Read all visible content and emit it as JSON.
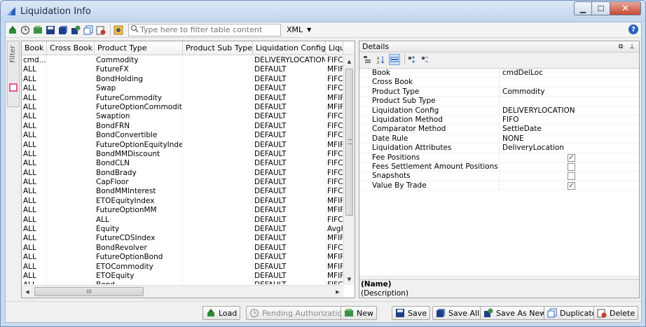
{
  "window": {
    "title": "Liquidation Info"
  },
  "toolbar": {
    "filter_placeholder": "Type here to filter table content",
    "format_selected": "XML"
  },
  "side_tab": {
    "label": "Filter"
  },
  "grid": {
    "columns": [
      "Book",
      "Cross Book",
      "Product Type",
      "Product Sub Type",
      "Liquidation Config",
      "Liqu"
    ],
    "rows": [
      [
        "cmd...",
        "",
        "Commodity",
        "",
        "DELIVERYLOCATION",
        "FIFC"
      ],
      [
        "ALL",
        "",
        "FutureFX",
        "",
        "DEFAULT",
        "MFIF"
      ],
      [
        "ALL",
        "",
        "BondHolding",
        "",
        "DEFAULT",
        "FIFC"
      ],
      [
        "ALL",
        "",
        "Swap",
        "",
        "DEFAULT",
        "FIFC"
      ],
      [
        "ALL",
        "",
        "FutureCommodity",
        "",
        "DEFAULT",
        "MFIF"
      ],
      [
        "ALL",
        "",
        "FutureOptionCommodity",
        "",
        "DEFAULT",
        "MFIF"
      ],
      [
        "ALL",
        "",
        "Swaption",
        "",
        "DEFAULT",
        "FIFC"
      ],
      [
        "ALL",
        "",
        "BondFRN",
        "",
        "DEFAULT",
        "FIFC"
      ],
      [
        "ALL",
        "",
        "BondConvertible",
        "",
        "DEFAULT",
        "FIFC"
      ],
      [
        "ALL",
        "",
        "FutureOptionEquityIndex",
        "",
        "DEFAULT",
        "MFIF"
      ],
      [
        "ALL",
        "",
        "BondMMDiscount",
        "",
        "DEFAULT",
        "FIFC"
      ],
      [
        "ALL",
        "",
        "BondCLN",
        "",
        "DEFAULT",
        "FIFC"
      ],
      [
        "ALL",
        "",
        "BondBrady",
        "",
        "DEFAULT",
        "FIFC"
      ],
      [
        "ALL",
        "",
        "CapFloor",
        "",
        "DEFAULT",
        "FIFC"
      ],
      [
        "ALL",
        "",
        "BondMMInterest",
        "",
        "DEFAULT",
        "FIFC"
      ],
      [
        "ALL",
        "",
        "ETOEquityIndex",
        "",
        "DEFAULT",
        "MFIF"
      ],
      [
        "ALL",
        "",
        "FutureOptionMM",
        "",
        "DEFAULT",
        "MFIF"
      ],
      [
        "ALL",
        "",
        "ALL",
        "",
        "DEFAULT",
        "FIFC"
      ],
      [
        "ALL",
        "",
        "Equity",
        "",
        "DEFAULT",
        "AvgF"
      ],
      [
        "ALL",
        "",
        "FutureCDSIndex",
        "",
        "DEFAULT",
        "MFIF"
      ],
      [
        "ALL",
        "",
        "BondRevolver",
        "",
        "DEFAULT",
        "FIFC"
      ],
      [
        "ALL",
        "",
        "FutureOptionBond",
        "",
        "DEFAULT",
        "MFIF"
      ],
      [
        "ALL",
        "",
        "ETOCommodity",
        "",
        "DEFAULT",
        "MFIF"
      ],
      [
        "ALL",
        "",
        "ETOEquity",
        "",
        "DEFAULT",
        "MFIF"
      ],
      [
        "ALL",
        "",
        "Bond",
        "",
        "DEFAULT",
        "FIFC"
      ]
    ]
  },
  "details": {
    "title": "Details",
    "properties": [
      {
        "name": "Book",
        "value": "cmdDelLoc",
        "type": "text"
      },
      {
        "name": "Cross Book",
        "value": "",
        "type": "text"
      },
      {
        "name": "Product Type",
        "value": "Commodity",
        "type": "text"
      },
      {
        "name": "Product Sub Type",
        "value": "",
        "type": "text"
      },
      {
        "name": "Liquidation Config",
        "value": "DELIVERYLOCATION",
        "type": "text"
      },
      {
        "name": "Liquidation Method",
        "value": "FIFO",
        "type": "text"
      },
      {
        "name": "Comparator Method",
        "value": "SettleDate",
        "type": "text"
      },
      {
        "name": "Date Rule",
        "value": "NONE",
        "type": "text"
      },
      {
        "name": "Liquidation Attributes",
        "value": "DeliveryLocation",
        "type": "text"
      },
      {
        "name": "Fee Positions",
        "value": "✓",
        "type": "checkbox"
      },
      {
        "name": "Fees Settlement Amount Positions",
        "value": "",
        "type": "checkbox"
      },
      {
        "name": "Snapshots",
        "value": "",
        "type": "checkbox"
      },
      {
        "name": "Value By Trade",
        "value": "✓",
        "type": "checkbox"
      }
    ],
    "description_name": "(Name)",
    "description_text": "(Description)"
  },
  "buttons": {
    "load": "Load",
    "pending": "Pending Authorization",
    "new": "New",
    "save": "Save",
    "save_all": "Save All",
    "save_as_new": "Save As New",
    "duplicate": "Duplicate",
    "delete": "Delete"
  },
  "colors": {
    "accent_blue": "#2a62b8",
    "delete_red": "#c73a2a",
    "save_navy": "#1f3f86",
    "load_green": "#2e8b3a"
  }
}
